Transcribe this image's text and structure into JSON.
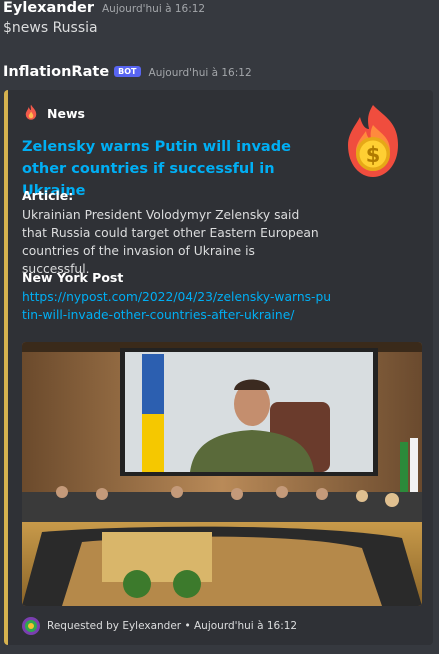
{
  "message1": {
    "author": "Eylexander",
    "timestamp": "Aujourd'hui à 16:12",
    "content": "$news Russia"
  },
  "message2": {
    "author": "InflationRate",
    "bot_tag": "BOT",
    "timestamp": "Aujourd'hui à 16:12"
  },
  "embed": {
    "accent_color": "#d6b24f",
    "author_icon": "fire-icon",
    "author_name": "News",
    "title": "Zelensky warns Putin will invade other countries if successful in Ukraine",
    "thumbnail_icon": "fire-dollar-coin-icon",
    "fields": [
      {
        "name": "Article:",
        "value": "Ukrainian President Volodymyr Zelensky said that Russia could target other Eastern European countries of the invasion of Ukraine is successful."
      },
      {
        "name": "New York Post",
        "value": "https://nypost.com/2022/04/23/zelensky-warns-putin-will-invade-other-countries-after-ukraine/"
      }
    ],
    "image_icon": "conference-photo",
    "footer_icon": "requester-avatar",
    "footer_text": "Requested by Eylexander • Aujourd'hui à 16:12"
  }
}
